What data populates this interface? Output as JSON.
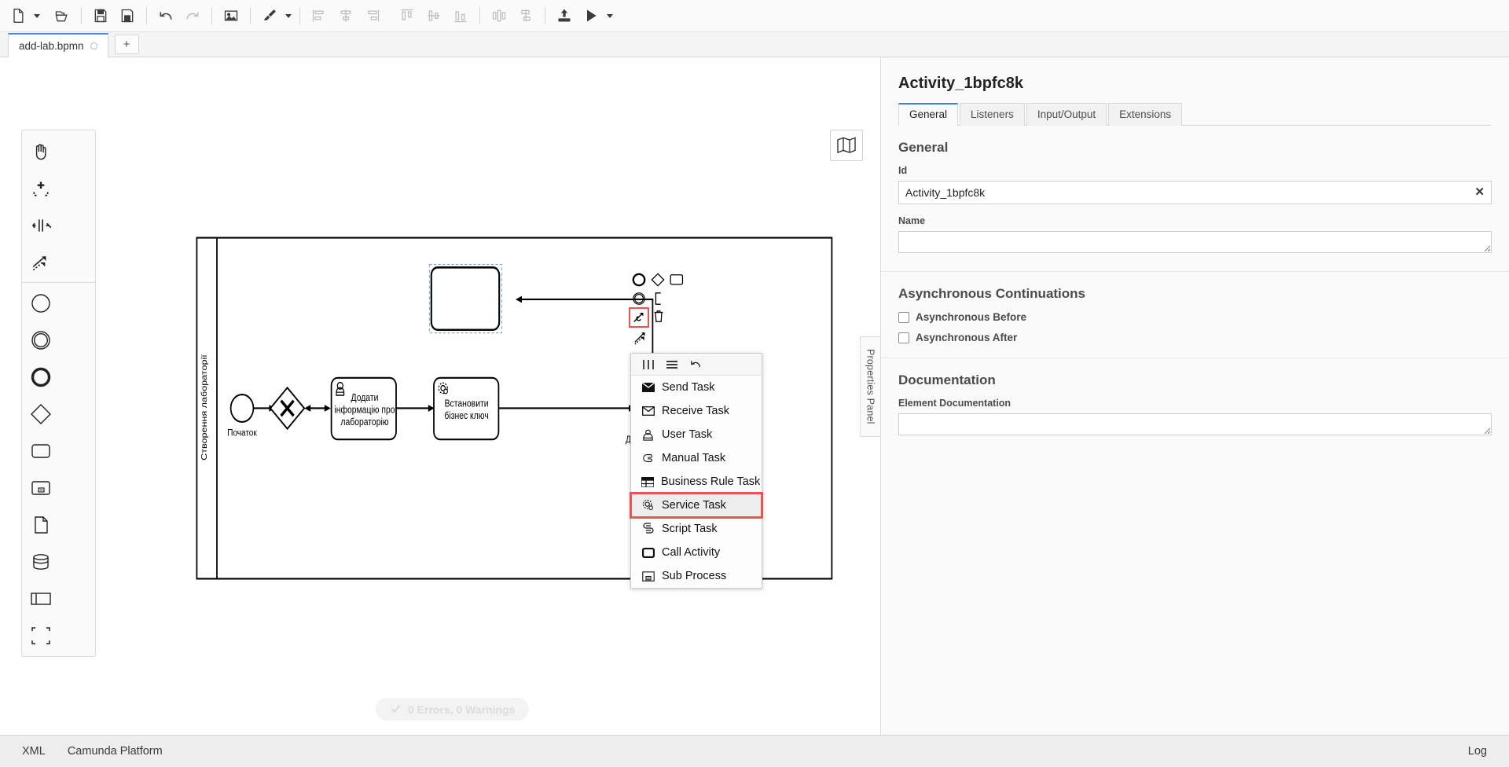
{
  "toolbar": {
    "groups": [
      [
        {
          "name": "new-file-icon",
          "label": "New file",
          "caret": true
        }
      ],
      [
        {
          "name": "open-file-icon",
          "label": "Open file"
        }
      ],
      [
        {
          "name": "save-icon",
          "label": "Save"
        },
        {
          "name": "save-as-icon",
          "label": "Save as"
        }
      ],
      [
        {
          "name": "undo-icon",
          "label": "Undo"
        },
        {
          "name": "redo-icon",
          "label": "Redo"
        }
      ],
      [
        {
          "name": "export-image-icon",
          "label": "Export as image"
        }
      ],
      [
        {
          "name": "brush-icon",
          "label": "Set color",
          "caret": true
        }
      ],
      [
        {
          "name": "align-left-icon",
          "label": "Align left"
        },
        {
          "name": "align-center-icon",
          "label": "Align center"
        },
        {
          "name": "align-right-icon",
          "label": "Align right"
        }
      ],
      [
        {
          "name": "align-top-icon",
          "label": "Align top"
        },
        {
          "name": "align-middle-icon",
          "label": "Align middle"
        },
        {
          "name": "align-bottom-icon",
          "label": "Align bottom"
        }
      ],
      [
        {
          "name": "distribute-horizontal-icon",
          "label": "Distribute horizontally"
        },
        {
          "name": "distribute-vertical-icon",
          "label": "Distribute vertically"
        }
      ],
      [
        {
          "name": "deploy-icon",
          "label": "Deploy current diagram"
        },
        {
          "name": "start-instance-icon",
          "label": "Start current diagram",
          "caret": true
        }
      ]
    ]
  },
  "tabs": {
    "items": [
      {
        "label": "add-lab.bpmn",
        "dirty_icon": "unsaved-dot-icon"
      }
    ],
    "add_label": "+"
  },
  "palette": {
    "tools": [
      {
        "name": "hand-tool-icon",
        "label": "Activate the hand tool"
      },
      {
        "name": "lasso-tool-icon",
        "label": "Activate the lasso tool"
      },
      {
        "name": "space-tool-icon",
        "label": "Activate the create/remove space tool"
      },
      {
        "name": "global-connect-tool-icon",
        "label": "Activate the global connect tool"
      }
    ],
    "elements": [
      {
        "name": "start-event-icon",
        "label": "Create StartEvent"
      },
      {
        "name": "intermediate-event-icon",
        "label": "Create Intermediate/Boundary Event"
      },
      {
        "name": "end-event-icon",
        "label": "Create EndEvent"
      },
      {
        "name": "exclusive-gateway-icon",
        "label": "Create Gateway"
      },
      {
        "name": "task-icon",
        "label": "Create Task"
      },
      {
        "name": "subprocess-expanded-icon",
        "label": "Create expanded SubProcess"
      },
      {
        "name": "data-object-icon",
        "label": "Create DataObjectReference"
      },
      {
        "name": "data-store-icon",
        "label": "Create DataStoreReference"
      },
      {
        "name": "participant-icon",
        "label": "Create Pool/Participant"
      },
      {
        "name": "group-icon",
        "label": "Create Group"
      }
    ]
  },
  "canvas": {
    "minimap_icon": "minimap-icon",
    "lane_label": "Створення лабораторії",
    "nodes": {
      "start_event_label": "Початок",
      "task_user_label": "Додати інформацію про лабораторію",
      "task_service_label": "Встановити бізнес ключ",
      "end_gateway_label": "Дані присутні?",
      "new_task_label": ""
    },
    "validation": {
      "icon": "check-icon",
      "text": "0 Errors, 0 Warnings"
    },
    "context_pad": [
      {
        "name": "append-end-event-icon",
        "label": "Append EndEvent"
      },
      {
        "name": "append-gateway-icon",
        "label": "Append Gateway"
      },
      {
        "name": "append-task-icon",
        "label": "Append Task"
      },
      {
        "name": "append-intermediate-event-icon",
        "label": "Append Intermediate/Boundary Event"
      },
      {
        "name": "append-text-annotation-icon",
        "label": "Append TextAnnotation"
      },
      {
        "name": "change-type-icon",
        "label": "Change type"
      },
      {
        "name": "delete-icon",
        "label": "Remove"
      },
      {
        "name": "connect-icon",
        "label": "Connect using Sequence/MessageFlow"
      }
    ]
  },
  "replace_menu": {
    "header_icons": [
      {
        "name": "columns-icon",
        "label": "Toggle columns"
      },
      {
        "name": "list-icon",
        "label": "Toggle list"
      },
      {
        "name": "loop-icon",
        "label": "Loop"
      }
    ],
    "items": [
      {
        "label": "Send Task",
        "icon": "send-task-icon",
        "selected": false
      },
      {
        "label": "Receive Task",
        "icon": "receive-task-icon",
        "selected": false
      },
      {
        "label": "User Task",
        "icon": "user-task-icon",
        "selected": false
      },
      {
        "label": "Manual Task",
        "icon": "manual-task-icon",
        "selected": false
      },
      {
        "label": "Business Rule Task",
        "icon": "business-rule-task-icon",
        "selected": false
      },
      {
        "label": "Service Task",
        "icon": "service-task-icon",
        "selected": true
      },
      {
        "label": "Script Task",
        "icon": "script-task-icon",
        "selected": false
      },
      {
        "label": "Call Activity",
        "icon": "call-activity-icon",
        "selected": false
      },
      {
        "label": "Sub Process",
        "icon": "sub-process-icon",
        "selected": false
      }
    ]
  },
  "properties": {
    "title": "Activity_1bpfc8k",
    "tabs": [
      {
        "label": "General",
        "active": true
      },
      {
        "label": "Listeners",
        "active": false
      },
      {
        "label": "Input/Output",
        "active": false
      },
      {
        "label": "Extensions",
        "active": false
      }
    ],
    "general_section": "General",
    "id_label": "Id",
    "id_value": "Activity_1bpfc8k",
    "id_clear_icon": "clear-icon",
    "name_label": "Name",
    "name_value": "",
    "async_section": "Asynchronous Continuations",
    "async_before_label": "Asynchronous Before",
    "async_after_label": "Asynchronous After",
    "documentation_section": "Documentation",
    "element_doc_label": "Element Documentation",
    "element_doc_value": "",
    "panel_handle_label": "Properties Panel"
  },
  "statusbar": {
    "left": [
      {
        "label": "XML"
      },
      {
        "label": "Camunda Platform"
      }
    ],
    "right": [
      {
        "label": "Log"
      }
    ]
  },
  "colors": {
    "accent": "#3f80e0",
    "selection_red": "#ef5350",
    "selection_blue": "#7ba7e8",
    "panel_bg": "#fafafa",
    "toolbar_bg": "#fafafa",
    "statusbar_bg": "#ededed"
  }
}
